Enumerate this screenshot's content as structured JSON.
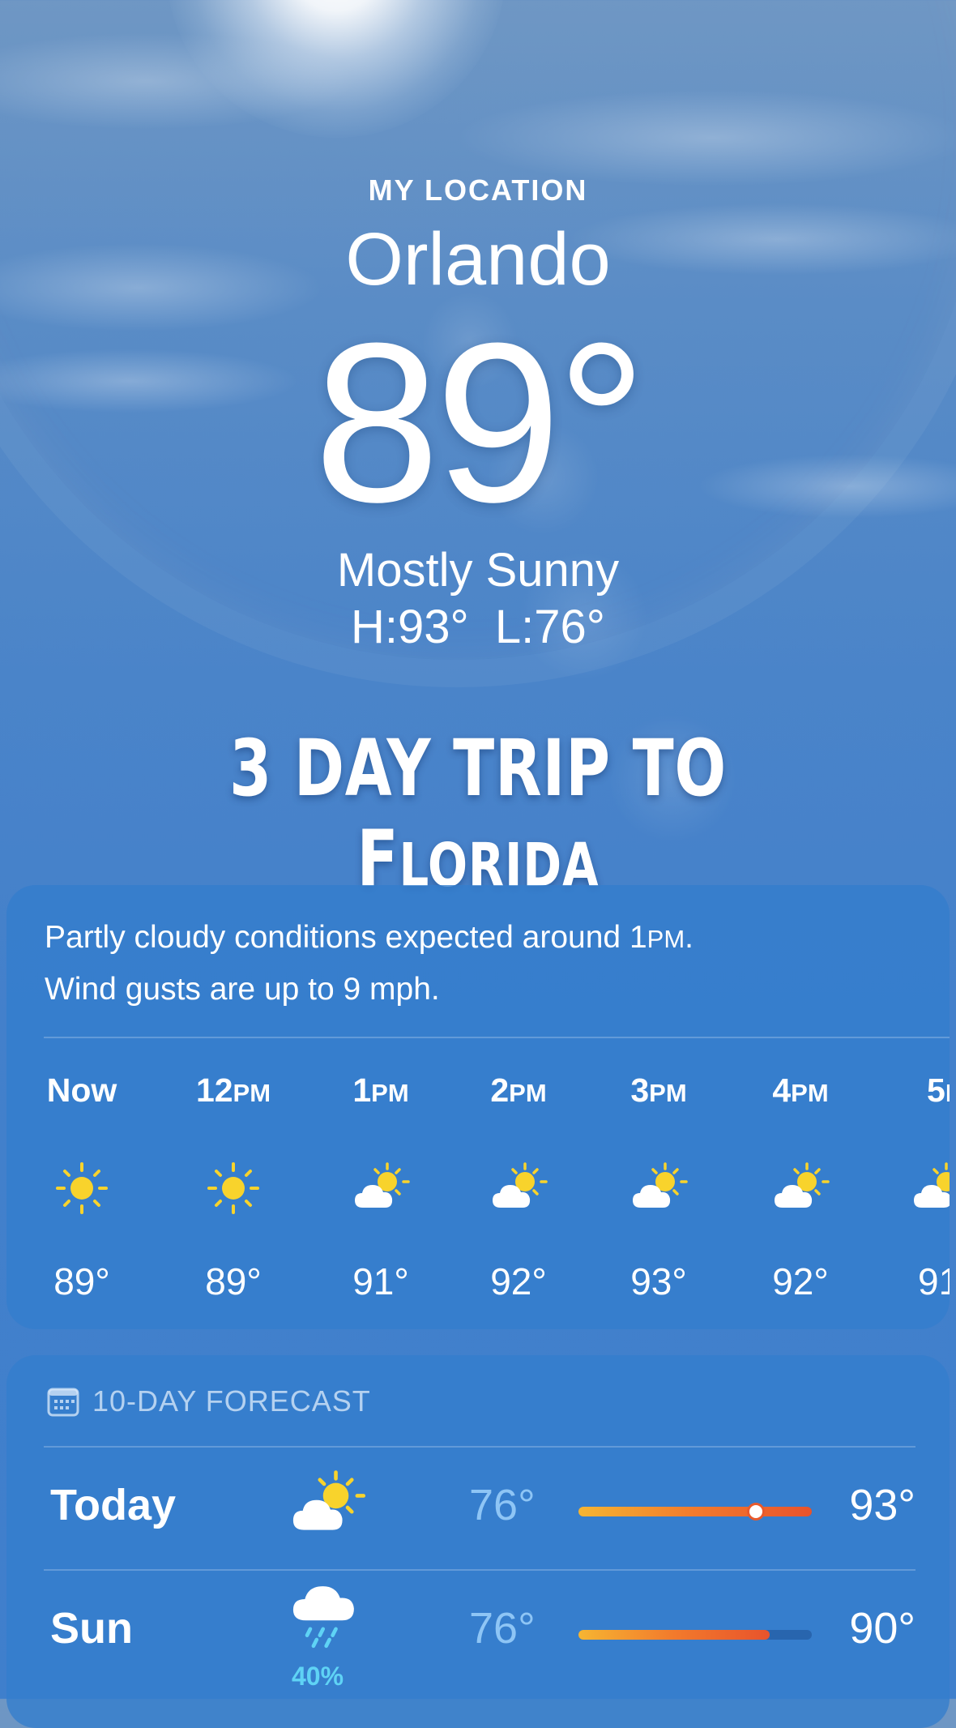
{
  "header": {
    "location_label": "MY LOCATION",
    "city": "Orlando",
    "temperature": "89°",
    "condition": "Mostly Sunny",
    "high_low": "H:93°  L:76°"
  },
  "overlay_title": {
    "part1": "3 DAY TRIP TO F",
    "part2": "LORIDA"
  },
  "hourly_card": {
    "summary_line1_a": "Partly cloudy conditions expected around 1",
    "summary_line1_b": "PM",
    "summary_line1_c": ".",
    "summary_line2": "Wind gusts are up to 9 mph.",
    "hours": [
      {
        "num": "Now",
        "suffix": "",
        "icon": "sun-icon",
        "temp": "89°"
      },
      {
        "num": "12",
        "suffix": "PM",
        "icon": "sun-icon",
        "temp": "89°"
      },
      {
        "num": "1",
        "suffix": "PM",
        "icon": "partly-cloudy-icon",
        "temp": "91°"
      },
      {
        "num": "2",
        "suffix": "PM",
        "icon": "partly-cloudy-icon",
        "temp": "92°"
      },
      {
        "num": "3",
        "suffix": "PM",
        "icon": "partly-cloudy-icon",
        "temp": "93°"
      },
      {
        "num": "4",
        "suffix": "PM",
        "icon": "partly-cloudy-icon",
        "temp": "92°"
      },
      {
        "num": "5",
        "suffix": "P",
        "icon": "partly-cloudy-icon",
        "temp": "91"
      }
    ]
  },
  "forecast_card": {
    "title": "10-DAY FORECAST",
    "icon": "calendar-icon",
    "days": [
      {
        "day": "Today",
        "icon": "partly-cloudy-icon",
        "low": "76°",
        "high": "93°",
        "precip": "",
        "range_start": 0.0,
        "range_end": 1.0,
        "current_position": 0.76
      },
      {
        "day": "Sun",
        "icon": "rain-icon",
        "low": "76°",
        "high": "90°",
        "precip": "40%",
        "range_start": 0.0,
        "range_end": 0.82
      }
    ]
  },
  "colors": {
    "accent_low_temp": "#8ec5f5",
    "precip": "#5fd3f5",
    "bar_gradient_start": "#f6b532",
    "bar_gradient_end": "#e8532c"
  }
}
